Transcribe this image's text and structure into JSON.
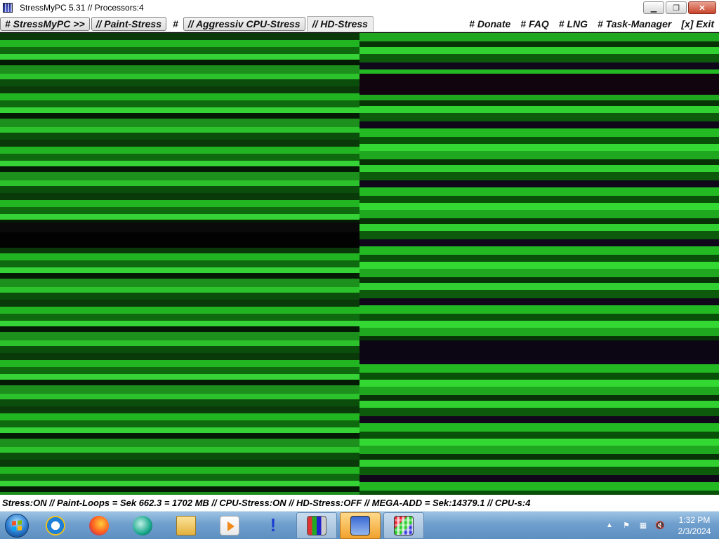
{
  "window": {
    "title": "StressMyPC 5.31 // Processors:4",
    "minimize_symbol": "▁",
    "maximize_symbol": "❐",
    "close_symbol": "✕"
  },
  "menu": {
    "items_left": [
      {
        "label": "# StressMyPC >>",
        "style": "btn"
      },
      {
        "label": "// Paint-Stress",
        "style": "btn"
      },
      {
        "label": "#",
        "style": "plain"
      },
      {
        "label": "// Aggressiv CPU-Stress",
        "style": "btn"
      },
      {
        "label": "// HD-Stress",
        "style": "plain"
      }
    ],
    "items_right": [
      "# Donate",
      "# FAQ",
      "# LNG",
      "# Task-Manager",
      "[x] Exit"
    ]
  },
  "status": {
    "text": "Stress:ON // Paint-Loops = Sek 662.3 = 1702 MB // CPU-Stress:ON // HD-Stress:OFF // MEGA-ADD = Sek:14379.1 // CPU-s:4"
  },
  "taskbar": {
    "apps": [
      {
        "name": "internet-explorer-icon",
        "cls": "ie",
        "state": ""
      },
      {
        "name": "firefox-icon",
        "cls": "ff",
        "state": ""
      },
      {
        "name": "media-center-icon",
        "cls": "wmp",
        "state": ""
      },
      {
        "name": "file-explorer-icon",
        "cls": "folder",
        "state": ""
      },
      {
        "name": "media-player-icon",
        "cls": "media",
        "state": ""
      },
      {
        "name": "alert-icon",
        "cls": "excl",
        "state": "",
        "glyph": "!"
      },
      {
        "name": "stressmypc-icon",
        "cls": "stress1",
        "state": "active"
      },
      {
        "name": "paint-stress-icon",
        "cls": "stress2",
        "state": "highlight"
      },
      {
        "name": "grid-app-icon",
        "cls": "grid",
        "state": "active"
      }
    ],
    "tray": {
      "show_hidden_symbol": "▲",
      "flag_symbol": "⚑",
      "network_symbol": "▦",
      "volume_symbol": "🔇"
    },
    "clock": {
      "time": "1:32 PM",
      "date": "2/3/2024"
    }
  },
  "colors": {
    "canvas_green": "#21b521",
    "canvas_dark": "#041a04",
    "taskbar": "#6f9fcd"
  }
}
